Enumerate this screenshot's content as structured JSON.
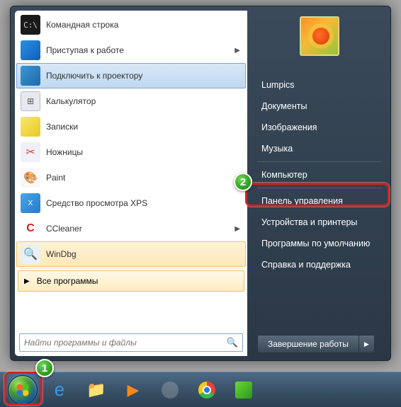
{
  "left": {
    "items": [
      {
        "label": "Командная строка",
        "icon": "cmd",
        "arrow": false
      },
      {
        "label": "Приступая к работе",
        "icon": "getting-started",
        "arrow": true
      },
      {
        "label": "Подключить к проектору",
        "icon": "projector",
        "arrow": false,
        "state": "highlighted"
      },
      {
        "label": "Калькулятор",
        "icon": "calculator",
        "arrow": false
      },
      {
        "label": "Записки",
        "icon": "sticky-notes",
        "arrow": false
      },
      {
        "label": "Ножницы",
        "icon": "snipping-tool",
        "arrow": false
      },
      {
        "label": "Paint",
        "icon": "paint",
        "arrow": false
      },
      {
        "label": "Средство просмотра XPS",
        "icon": "xps-viewer",
        "arrow": false
      },
      {
        "label": "CCleaner",
        "icon": "ccleaner",
        "arrow": true
      },
      {
        "label": "WinDbg",
        "icon": "windbg",
        "arrow": false,
        "state": "windbg-hl"
      }
    ],
    "all_programs": "Все программы",
    "search_placeholder": "Найти программы и файлы"
  },
  "right": {
    "items": [
      "Lumpics",
      "Документы",
      "Изображения",
      "Музыка",
      "Компьютер",
      "Панель управления",
      "Устройства и принтеры",
      "Программы по умолчанию",
      "Справка и поддержка"
    ],
    "shutdown": "Завершение работы"
  },
  "badges": {
    "b1": "1",
    "b2": "2"
  },
  "taskbar_icons": [
    "start",
    "ie",
    "explorer",
    "wmp",
    "blank",
    "chrome",
    "app-green"
  ]
}
